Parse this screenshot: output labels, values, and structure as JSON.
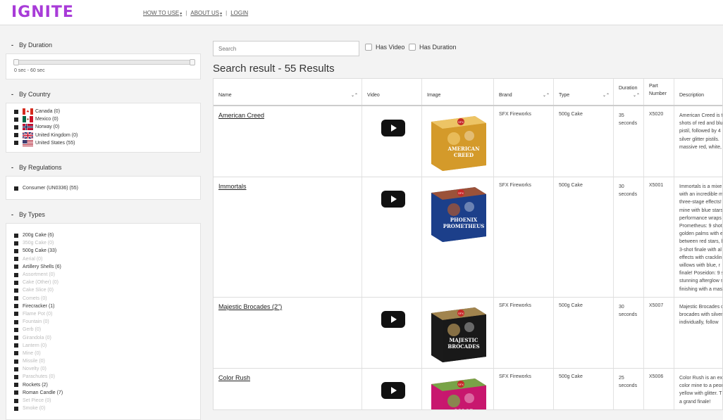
{
  "app": {
    "logo": "IGNITE"
  },
  "nav": [
    {
      "label": "HOW TO USE",
      "caret": "▾"
    },
    {
      "label": "ABOUT US",
      "caret": "▾"
    },
    {
      "label": "LOGIN",
      "caret": ""
    }
  ],
  "nav_sep": "|",
  "sidebar": {
    "duration": {
      "title": "By Duration",
      "range_label": "0 sec - 60 sec",
      "min": 0,
      "max": 60
    },
    "country": {
      "title": "By Country",
      "items": [
        {
          "label": "Canada (0)",
          "flag": "ca-flag-icon"
        },
        {
          "label": "Mexico (0)",
          "flag": "mx-flag-icon"
        },
        {
          "label": "Norway (0)",
          "flag": "no-flag-icon"
        },
        {
          "label": "United Kingdom (0)",
          "flag": "gb-flag-icon"
        },
        {
          "label": "United States (55)",
          "flag": "us-flag-icon"
        }
      ]
    },
    "regulations": {
      "title": "By Regulations",
      "items": [
        {
          "label": "Consumer (UN0336) (55)"
        }
      ]
    },
    "types": {
      "title": "By Types",
      "items": [
        {
          "label": "200g Cake (6)",
          "dim": false
        },
        {
          "label": "350g Cake (0)",
          "dim": true
        },
        {
          "label": "500g Cake (33)",
          "dim": false
        },
        {
          "label": "Aerial (0)",
          "dim": true
        },
        {
          "label": "Artillery Shells (6)",
          "dim": false
        },
        {
          "label": "Assortment (0)",
          "dim": true
        },
        {
          "label": "Cake (Other) (0)",
          "dim": true
        },
        {
          "label": "Cake Slice (0)",
          "dim": true
        },
        {
          "label": "Comets (0)",
          "dim": true
        },
        {
          "label": "Firecracker (1)",
          "dim": false
        },
        {
          "label": "Flame Pot (0)",
          "dim": true
        },
        {
          "label": "Fountain (0)",
          "dim": true
        },
        {
          "label": "Gerb (0)",
          "dim": true
        },
        {
          "label": "Girandola (0)",
          "dim": true
        },
        {
          "label": "Lantern (0)",
          "dim": true
        },
        {
          "label": "Mine (0)",
          "dim": true
        },
        {
          "label": "Missile (0)",
          "dim": true
        },
        {
          "label": "Novelty (0)",
          "dim": true
        },
        {
          "label": "Parachutes (0)",
          "dim": true
        },
        {
          "label": "Rockets (2)",
          "dim": false
        },
        {
          "label": "Roman Candle (7)",
          "dim": false
        },
        {
          "label": "Set Piece (0)",
          "dim": true
        },
        {
          "label": "Smoke (0)",
          "dim": true
        }
      ]
    }
  },
  "main": {
    "search_placeholder": "Search",
    "has_video_label": "Has Video",
    "has_duration_label": "Has Duration",
    "result_title": "Search result - 55 Results",
    "columns": [
      "Name",
      "Video",
      "Image",
      "Brand",
      "Type",
      "Duration",
      "Part Number",
      "Description"
    ],
    "column_part_number_lines": [
      "Part",
      "Number"
    ],
    "sort_icon": "⌄⌃",
    "rows": [
      {
        "name": "American Creed",
        "brand": "SFX Fireworks",
        "type": "500g Cake",
        "duration_lines": [
          "35",
          "seconds"
        ],
        "part": "X5020",
        "desc": [
          "American Creed is t",
          "shots of red and blu",
          "pistil, followed by 4",
          "silver glitter pistils.",
          "massive red, white,"
        ],
        "img_text": [
          "AMERICAN",
          "CREED"
        ],
        "img_colors": [
          "#d49a2a",
          "#f5d27a"
        ]
      },
      {
        "name": "Immortals",
        "brand": "SFX Fireworks",
        "type": "500g Cake",
        "duration_lines": [
          "30",
          "seconds"
        ],
        "part": "X5001",
        "desc": [
          "Immortals is a mixe",
          "with an incredible m",
          "three-stage effects!",
          "mine with blue stars",
          "performance wraps",
          "Prometheus: 9 shot",
          "golden palms with e",
          "between red stars, b",
          "3-shot finale with al",
          "effects with cracklin",
          "willows with blue, r",
          "finale! Poseidon: 9 s",
          "stunning afterglow s",
          "finishing with a mas"
        ],
        "img_text": [
          "PHOENIX",
          "PROMETHEUS"
        ],
        "img_colors": [
          "#1c3f8a",
          "#c65a1e"
        ]
      },
      {
        "name": "Majestic Brocades (2\")",
        "brand": "SFX Fireworks",
        "type": "500g Cake",
        "duration_lines": [
          "30",
          "seconds"
        ],
        "part": "X5007",
        "desc": [
          "Majestic Brocades d",
          "brocades with silver",
          "individually, follow"
        ],
        "img_text": [
          "MAJESTIC",
          "BROCADES"
        ],
        "img_colors": [
          "#1a1a1a",
          "#cfa860"
        ]
      },
      {
        "name": "Color Rush",
        "brand": "SFX Fireworks",
        "type": "500g Cake",
        "duration_lines": [
          "25",
          "seconds"
        ],
        "part": "X5006",
        "desc": [
          "Color Rush is an exp",
          "color mine to a peon",
          "yellow with glitter. T",
          "a grand finale!"
        ],
        "img_text": [
          "COLOR",
          "RUSH"
        ],
        "img_colors": [
          "#c8186f",
          "#5fd13a"
        ]
      }
    ]
  }
}
